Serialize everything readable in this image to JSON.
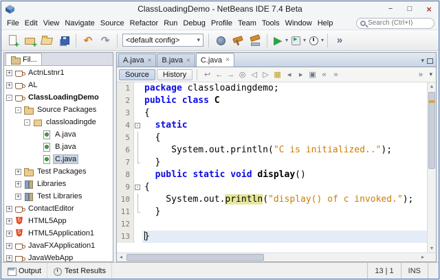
{
  "window": {
    "title": "ClassLoadingDemo - NetBeans IDE 7.4 Beta",
    "minimize_glyph": "−",
    "maximize_glyph": "□",
    "close_glyph": "×"
  },
  "menubar": {
    "items": [
      "File",
      "Edit",
      "View",
      "Navigate",
      "Source",
      "Refactor",
      "Run",
      "Debug",
      "Profile",
      "Team",
      "Tools",
      "Window",
      "Help"
    ]
  },
  "search": {
    "placeholder": "Search (Ctrl+I)"
  },
  "toolbar": {
    "config_combo": "<default config>",
    "items": [
      {
        "type": "icon",
        "name": "new-file"
      },
      {
        "type": "icon",
        "name": "new-project"
      },
      {
        "type": "icon",
        "name": "open-project"
      },
      {
        "type": "icon",
        "name": "save-all"
      },
      {
        "type": "sep"
      },
      {
        "type": "icon",
        "name": "undo"
      },
      {
        "type": "icon",
        "name": "redo"
      },
      {
        "type": "sep"
      },
      {
        "type": "combo"
      },
      {
        "type": "sep"
      },
      {
        "type": "icon",
        "name": "deploy"
      },
      {
        "type": "icon",
        "name": "build"
      },
      {
        "type": "icon",
        "name": "clean-build"
      },
      {
        "type": "sep"
      },
      {
        "type": "icon",
        "name": "run",
        "dropdown": true
      },
      {
        "type": "icon",
        "name": "debug",
        "dropdown": true
      },
      {
        "type": "icon",
        "name": "profile",
        "dropdown": true
      },
      {
        "type": "sep"
      },
      {
        "type": "icon",
        "name": "overflow"
      }
    ]
  },
  "projects_panel": {
    "tab_label": "Fil...",
    "tree": [
      {
        "label": "ActnLstnr1",
        "depth": 0,
        "handle": "+",
        "icon": "java-project"
      },
      {
        "label": "AL",
        "depth": 0,
        "handle": "+",
        "icon": "java-project"
      },
      {
        "label": "ClassLoadingDemo",
        "depth": 0,
        "handle": "-",
        "icon": "java-project",
        "bold": true
      },
      {
        "label": "Source Packages",
        "depth": 1,
        "handle": "-",
        "icon": "source-folder"
      },
      {
        "label": "classloadingde",
        "depth": 2,
        "handle": "-",
        "icon": "package"
      },
      {
        "label": "A.java",
        "depth": 3,
        "handle": null,
        "icon": "java-class"
      },
      {
        "label": "B.java",
        "depth": 3,
        "handle": null,
        "icon": "java-class"
      },
      {
        "label": "C.java",
        "depth": 3,
        "handle": null,
        "icon": "java-class",
        "selected": true
      },
      {
        "label": "Test Packages",
        "depth": 1,
        "handle": "+",
        "icon": "source-folder"
      },
      {
        "label": "Libraries",
        "depth": 1,
        "handle": "+",
        "icon": "libraries"
      },
      {
        "label": "Test Libraries",
        "depth": 1,
        "handle": "+",
        "icon": "libraries"
      },
      {
        "label": "ContactEditor",
        "depth": 0,
        "handle": "+",
        "icon": "java-project"
      },
      {
        "label": "HTML5App",
        "depth": 0,
        "handle": "+",
        "icon": "html5"
      },
      {
        "label": "HTML5Application1",
        "depth": 0,
        "handle": "+",
        "icon": "html5"
      },
      {
        "label": "JavaFXApplication1",
        "depth": 0,
        "handle": "+",
        "icon": "java-project"
      },
      {
        "label": "JavaWebApp",
        "depth": 0,
        "handle": "+",
        "icon": "java-project"
      }
    ]
  },
  "editor": {
    "tabs": [
      {
        "label": "A.java"
      },
      {
        "label": "B.java"
      },
      {
        "label": "C.java",
        "active": true
      }
    ],
    "close_glyph": "×",
    "views": [
      {
        "label": "Source",
        "active": true
      },
      {
        "label": "History"
      }
    ],
    "toolbar_icons": [
      "last-edit",
      "back",
      "forward",
      "find-selection",
      "find-previous",
      "find-next",
      "toggle-highlight",
      "previous-bookmark",
      "next-bookmark",
      "toggle-bookmark",
      "shift-left",
      "shift-right"
    ],
    "overflow_glyph": "»",
    "chevron_glyph": "▾",
    "code": {
      "lines": [
        {
          "n": 1,
          "tokens": [
            {
              "c": "kw",
              "s": "package"
            },
            {
              "c": "pl",
              "s": " classloadingdemo;"
            }
          ]
        },
        {
          "n": 2,
          "tokens": [
            {
              "c": "kw",
              "s": "public class "
            },
            {
              "c": "cls",
              "s": "C"
            }
          ]
        },
        {
          "n": 3,
          "tokens": [
            {
              "c": "pl",
              "s": "{"
            }
          ]
        },
        {
          "n": 4,
          "fold": "start",
          "tokens": [
            {
              "c": "pl",
              "s": "  "
            },
            {
              "c": "kw",
              "s": "static"
            }
          ]
        },
        {
          "n": 5,
          "fold": "mid",
          "tokens": [
            {
              "c": "pl",
              "s": "  {"
            }
          ]
        },
        {
          "n": 6,
          "fold": "mid",
          "tokens": [
            {
              "c": "pl",
              "s": "     System.out.println("
            },
            {
              "c": "str",
              "s": "\"C is initialized..\""
            },
            {
              "c": "pl",
              "s": ");"
            }
          ]
        },
        {
          "n": 7,
          "fold": "end",
          "tokens": [
            {
              "c": "pl",
              "s": "  }"
            }
          ]
        },
        {
          "n": 8,
          "tokens": [
            {
              "c": "pl",
              "s": "  "
            },
            {
              "c": "kw",
              "s": "public static void "
            },
            {
              "c": "meth",
              "s": "display"
            },
            {
              "c": "pl",
              "s": "()"
            }
          ]
        },
        {
          "n": 9,
          "fold": "start",
          "tokens": [
            {
              "c": "pl",
              "s": "{"
            }
          ]
        },
        {
          "n": 10,
          "fold": "mid",
          "tokens": [
            {
              "c": "pl",
              "s": "    System.out."
            },
            {
              "c": "hl",
              "s": "println"
            },
            {
              "c": "pl",
              "s": "("
            },
            {
              "c": "str",
              "s": "\"display() of c invoked.\""
            },
            {
              "c": "pl",
              "s": ");"
            }
          ]
        },
        {
          "n": 11,
          "fold": "end",
          "tokens": [
            {
              "c": "pl",
              "s": "  }"
            }
          ]
        },
        {
          "n": 12,
          "tokens": []
        },
        {
          "n": 13,
          "caret": true,
          "tokens": [
            {
              "c": "pl",
              "s": "}"
            }
          ]
        }
      ]
    }
  },
  "statusbar": {
    "panels": [
      {
        "label": "Output",
        "icon": "output"
      },
      {
        "label": "Test Results",
        "icon": "test-results"
      }
    ],
    "caret_position": "13 | 1",
    "mode": "INS"
  }
}
